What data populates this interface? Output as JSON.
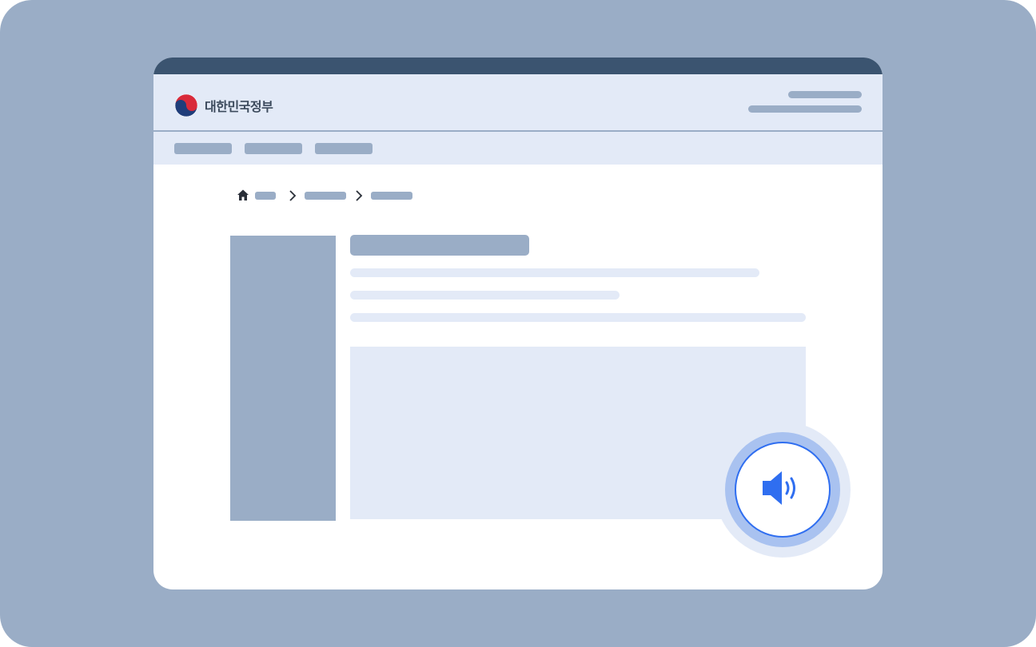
{
  "header": {
    "logo_text": "대한민국정부",
    "logo_icon": "taegeuk-emblem-icon"
  },
  "breadcrumb": {
    "home_icon": "home-icon",
    "separator_icon": "chevron-right-icon"
  },
  "audio": {
    "icon": "speaker-icon"
  },
  "colors": {
    "background": "#9aadc6",
    "titlebar": "#3b5470",
    "panel": "#e3eaf7",
    "placeholder": "#9aadc6",
    "accent": "#2f6ef0",
    "accent_ring": "#a9c2f0"
  }
}
